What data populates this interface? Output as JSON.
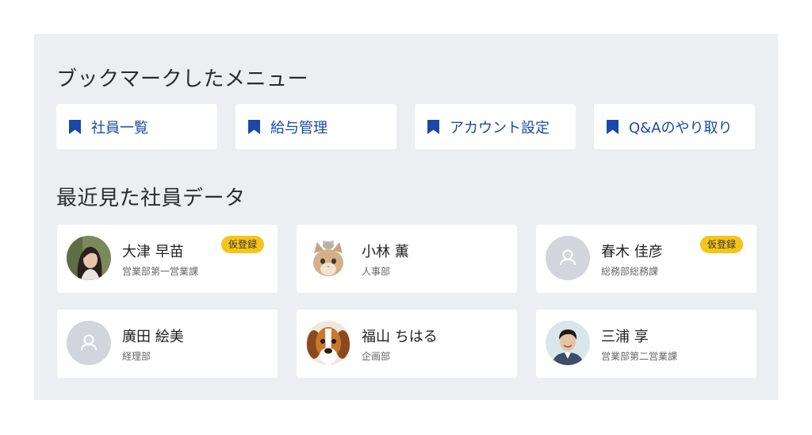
{
  "bookmarks": {
    "title": "ブックマークしたメニュー",
    "items": [
      {
        "label": "社員一覧"
      },
      {
        "label": "給与管理"
      },
      {
        "label": "アカウント設定"
      },
      {
        "label": "Q&Aのやり取り"
      }
    ],
    "icon": "bookmark-icon",
    "accent_color": "#1a48a8"
  },
  "recent": {
    "title": "最近見た社員データ",
    "employees": [
      {
        "name": "大津 早苗",
        "dept": "営業部第一営業課",
        "badge": "仮登録",
        "avatar": "woman-photo"
      },
      {
        "name": "小林 薫",
        "dept": "人事部",
        "avatar": "cat-photo"
      },
      {
        "name": "春木 佳彦",
        "dept": "総務部総務課",
        "badge": "仮登録",
        "avatar": "person-placeholder-icon"
      },
      {
        "name": "廣田 絵美",
        "dept": "経理部",
        "avatar": "person-placeholder-icon"
      },
      {
        "name": "福山 ちはる",
        "dept": "企画部",
        "avatar": "dog-photo"
      },
      {
        "name": "三浦 享",
        "dept": "営業部第二営業課",
        "avatar": "man-photo"
      }
    ],
    "badge_color": "#f5c518"
  }
}
